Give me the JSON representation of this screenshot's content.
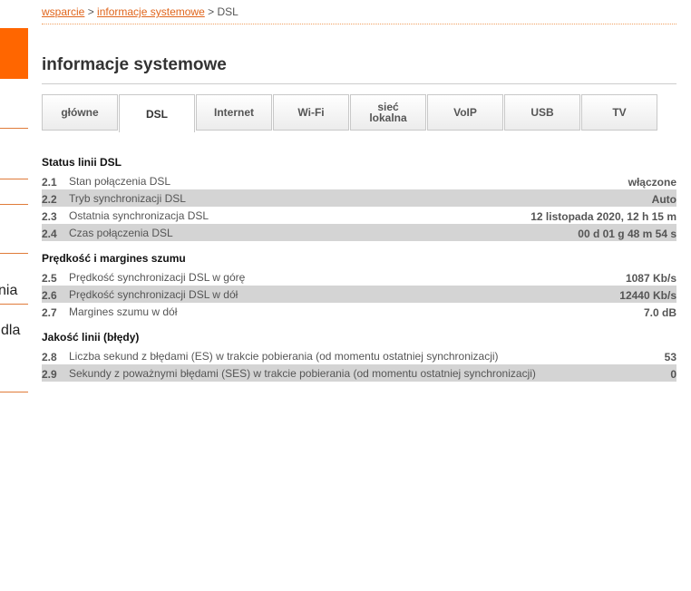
{
  "sidebar": {
    "fragment1": "nia",
    "fragment2": "dla"
  },
  "breadcrumb": {
    "link1": "wsparcie",
    "sep1": " > ",
    "link2": "informacje systemowe",
    "sep2": " > ",
    "current": "DSL"
  },
  "page_title": "informacje systemowe",
  "tabs": [
    {
      "label": "główne",
      "active": false
    },
    {
      "label": "DSL",
      "active": true
    },
    {
      "label": "Internet",
      "active": false
    },
    {
      "label": "Wi-Fi",
      "active": false
    },
    {
      "label_line1": "sieć",
      "label_line2": "lokalna",
      "active": false
    },
    {
      "label": "VoIP",
      "active": false
    },
    {
      "label": "USB",
      "active": false
    },
    {
      "label": "TV",
      "active": false
    }
  ],
  "sections": [
    {
      "title": "Status linii DSL",
      "rows": [
        {
          "num": "2.1",
          "label": "Stan połączenia DSL",
          "value": "włączone"
        },
        {
          "num": "2.2",
          "label": "Tryb synchronizacji DSL",
          "value": "Auto"
        },
        {
          "num": "2.3",
          "label": "Ostatnia synchronizacja DSL",
          "value": "12 listopada 2020, 12 h 15 m"
        },
        {
          "num": "2.4",
          "label": "Czas połączenia DSL",
          "value": "00 d 01 g 48 m 54 s"
        }
      ]
    },
    {
      "title": "Prędkość i margines szumu",
      "rows": [
        {
          "num": "2.5",
          "label": "Prędkość synchronizacji DSL w górę",
          "value": "1087 Kb/s"
        },
        {
          "num": "2.6",
          "label": "Prędkość synchronizacji DSL w dół",
          "value": "12440 Kb/s"
        },
        {
          "num": "2.7",
          "label": "Margines szumu w dół",
          "value": "7.0 dB"
        }
      ]
    },
    {
      "title": "Jakość linii (błędy)",
      "rows": [
        {
          "num": "2.8",
          "label": "Liczba sekund z błędami (ES) w trakcie pobierania (od momentu ostatniej synchronizacji)",
          "value": "53"
        },
        {
          "num": "2.9",
          "label": "Sekundy z poważnymi błędami (SES) w trakcie pobierania (od momentu ostatniej synchronizacji)",
          "value": "0"
        }
      ]
    }
  ],
  "colors": {
    "accent": "#ff6600",
    "link": "#e0651c",
    "row_shade": "#d4d4d4"
  }
}
